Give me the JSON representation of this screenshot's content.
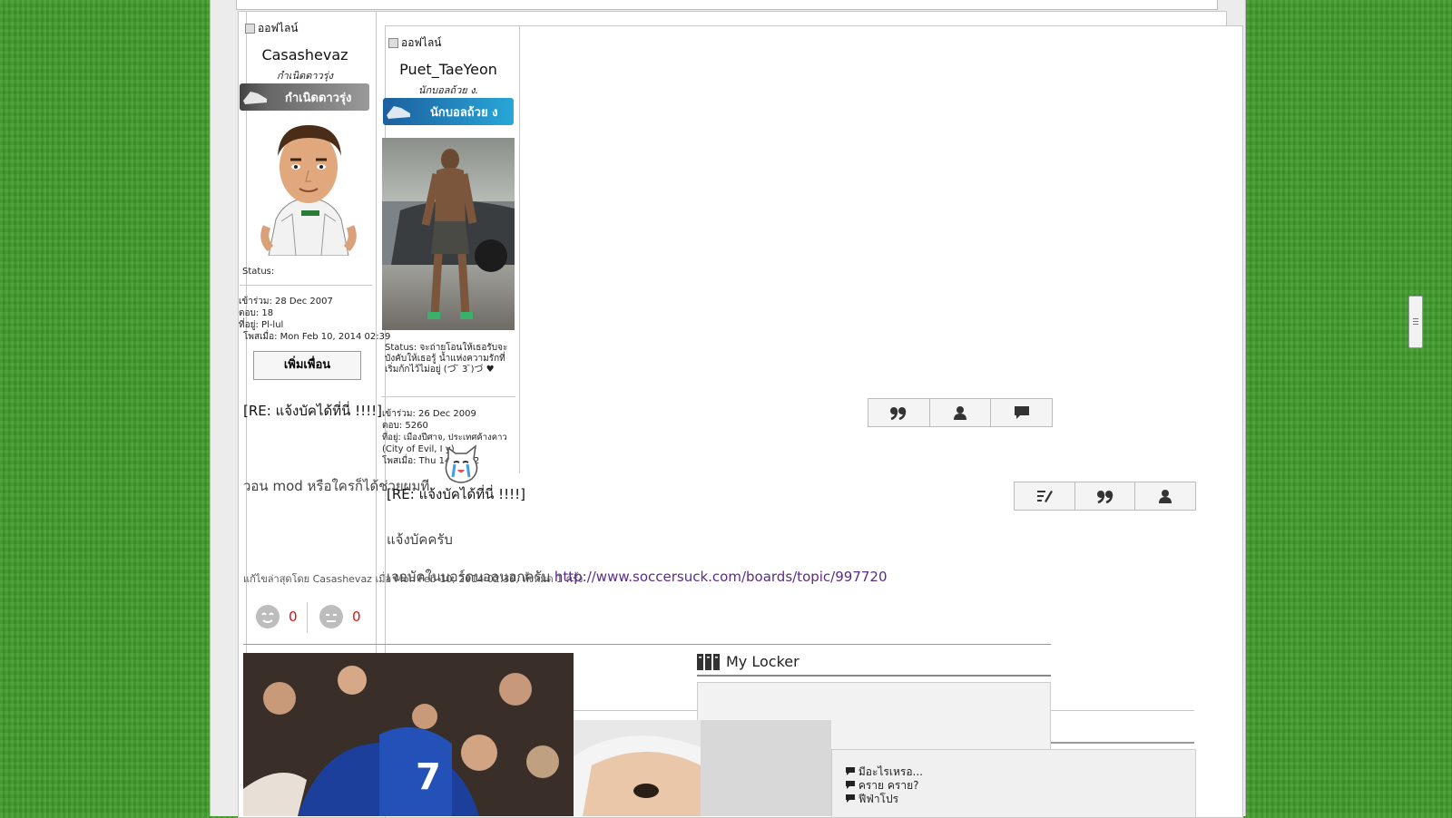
{
  "post1": {
    "status": "ออฟไลน์",
    "username": "Casashevaz",
    "rank": "กำเนิดดาวรุ่ง",
    "rank_badge": "กำเนิดดาวรุ่ง",
    "user_status": "Status:",
    "joined": "เข้าร่วม: 28 Dec 2007",
    "replies": "ตอบ: 18",
    "location": "ที่อยู่: Pl-lul",
    "posted": "โพสเมื่อ: Mon Feb 10, 2014 02:39",
    "add_friend": "เพิ่มเพื่อน",
    "title": "[RE: แจ้งบัคได้ที่นี่ !!!!]",
    "body": "วอน mod หรือใครก็ได้ช่วยผมที",
    "edited": "แก้ไขล่าสุดโดย Casashevaz เมื่อ Mon Feb 10, 2014 02:39, ทั้งหมด 1 ครั้ง",
    "like_count": "0",
    "dislike_count": "0"
  },
  "post2": {
    "status": "ออฟไลน์",
    "username": "Puet_TaeYeon",
    "rank": "นักบอลถ้วย ง.",
    "rank_badge": "นักบอลถ้วย ง",
    "user_status": "Status: จะถ่ายโอนให้เธอรับจะบังคับให้เธอรู้ น้ำแห่งความรักที่เริ่มก้กไว้ไม่อยู่ (づ ̄ 3 ̄)づ ♥",
    "joined": "เข้าร่วม: 26 Dec 2009",
    "replies": "ตอบ: 5260",
    "location": "ที่อยู่: เมืองปีศาจ, ประเทศค้างคาว",
    "location2": "(City of Evil, I        y)",
    "posted": "โพสเมื่อ: Thu          14 11:32",
    "title": "[RE: แจ้งบัคได้ที่นี่ !!!!]",
    "body": "แจ้งบัคครับ",
    "body2": "เจอบัคในบอร์ดบอลนอกครับ",
    "link": "http://www.soccersuck.com/boards/topic/997720"
  },
  "locker": {
    "title": "My Locker"
  },
  "sidebar_items": [
    "มีอะไรเหรอ...",
    "คราย คราย?",
    "ฟีฟ่าโปร"
  ],
  "icons": {
    "quote": "quote-icon",
    "profile": "user-icon",
    "comment": "comment-icon",
    "edit": "edit-icon"
  }
}
